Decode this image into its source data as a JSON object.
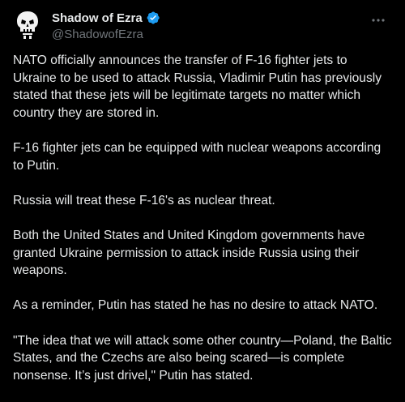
{
  "author": {
    "display_name": "Shadow of Ezra",
    "handle": "@ShadowofEzra",
    "avatar_icon": "skull-avatar-icon",
    "verified_icon": "verified-badge-icon"
  },
  "menu": {
    "icon": "more-options-icon"
  },
  "colors": {
    "background": "#000000",
    "text_primary": "#e7e9ea",
    "text_secondary": "#71767b",
    "verified_blue": "#1d9bf0"
  },
  "tweet": {
    "paragraphs": [
      "NATO officially announces the transfer of F-16 fighter jets to Ukraine to be used to attack Russia, Vladimir Putin has previously stated that these jets will be legitimate targets no matter which country they are stored in.",
      "F-16 fighter jets can be equipped with nuclear weapons according to Putin.",
      "Russia will treat these F-16's as nuclear threat.",
      "Both the United States and United Kingdom governments have granted Ukraine permission to attack inside Russia using their weapons.",
      "As a reminder, Putin has stated he has no desire to attack NATO.",
      "\"The idea that we will attack some other country—Poland, the Baltic States, and the Czechs are also being scared—is complete nonsense. It’s just drivel,\" Putin has stated."
    ]
  }
}
